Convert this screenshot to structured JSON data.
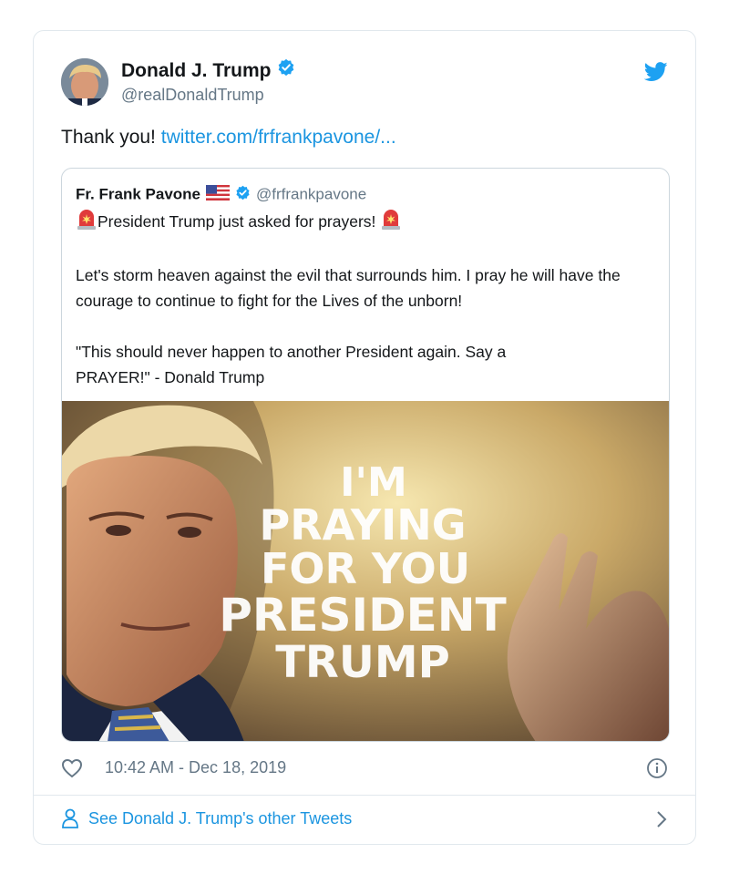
{
  "tweet": {
    "author_name": "Donald J. Trump",
    "author_handle": "@realDonaldTrump",
    "text": "Thank you!",
    "link": "twitter.com/frfrankpavone/...",
    "timestamp": "10:42 AM - Dec 18, 2019",
    "verified": true
  },
  "quoted": {
    "name": "Fr. Frank Pavone",
    "handle": "@frfrankpavone",
    "line1": "President Trump just asked for prayers!",
    "para2": "Let's storm heaven against the evil that surrounds him. I pray he will have the courage to continue to fight for the Lives of the unborn!",
    "para3_a": "\"This should never happen to another President again. Say a",
    "para3_b": "PRAYER!\"  - Donald Trump",
    "image_text": [
      "I'M",
      "PRAYING",
      "FOR YOU",
      "PRESIDENT",
      "TRUMP"
    ]
  },
  "footer": {
    "see_more": "See Donald J. Trump's other Tweets"
  },
  "icons": {
    "twitter": "twitter-bird-icon",
    "verified": "verified-badge-icon",
    "like": "heart-icon",
    "info": "info-icon",
    "person": "person-icon",
    "chevron": "chevron-right-icon",
    "siren": "police-light-emoji",
    "flag": "us-flag-emoji"
  },
  "colors": {
    "link": "#1b95e0",
    "secondary_text": "#657786",
    "border": "#e1e8ed"
  }
}
